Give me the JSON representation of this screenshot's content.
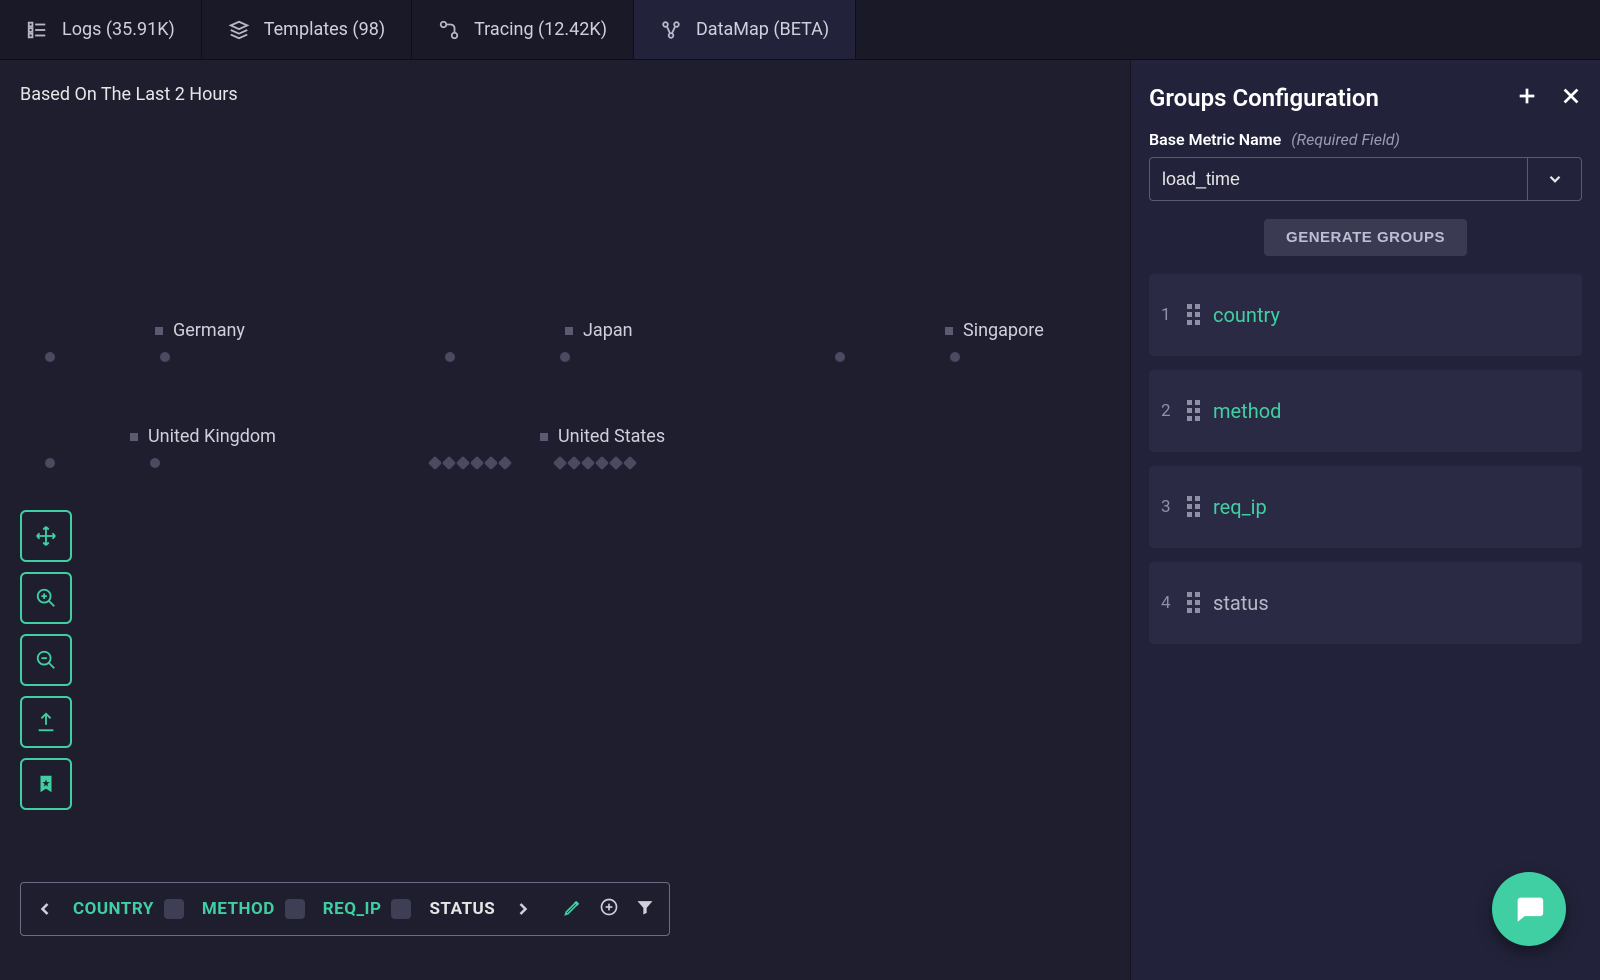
{
  "tabs": [
    {
      "label": "Logs (35.91K)"
    },
    {
      "label": "Templates (98)"
    },
    {
      "label": "Tracing (12.42K)"
    },
    {
      "label": "DataMap (BETA)",
      "active": true
    }
  ],
  "canvas": {
    "range_label": "Based On The Last 2 Hours",
    "clusters": [
      {
        "label": "Germany"
      },
      {
        "label": "Japan"
      },
      {
        "label": "Singapore"
      },
      {
        "label": "United Kingdom"
      },
      {
        "label": "United States"
      }
    ]
  },
  "toolrail": {
    "buttons": [
      "move",
      "zoom-in",
      "zoom-out",
      "export",
      "bookmark"
    ]
  },
  "breadcrumb": {
    "items": [
      {
        "label": "COUNTRY",
        "active": true
      },
      {
        "label": "METHOD",
        "active": true
      },
      {
        "label": "REQ_IP",
        "active": true
      },
      {
        "label": "STATUS",
        "active": false
      }
    ]
  },
  "panel": {
    "title": "Groups Configuration",
    "metric_label": "Base Metric Name",
    "metric_required": "(Required Field)",
    "metric_value": "load_time",
    "generate_label": "GENERATE GROUPS",
    "groups": [
      {
        "idx": "1",
        "name": "country",
        "active": true
      },
      {
        "idx": "2",
        "name": "method",
        "active": true
      },
      {
        "idx": "3",
        "name": "req_ip",
        "active": true
      },
      {
        "idx": "4",
        "name": "status",
        "active": false
      }
    ]
  }
}
